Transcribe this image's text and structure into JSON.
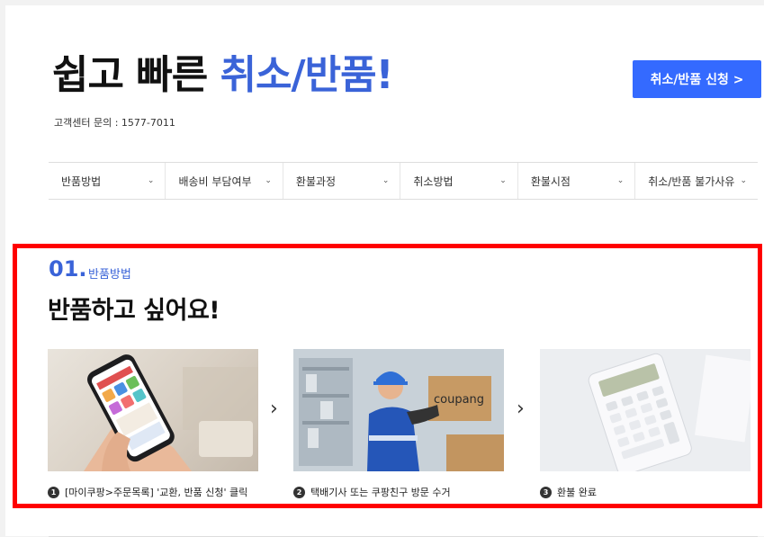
{
  "header": {
    "title_main": "쉽고 빠른 ",
    "title_accent": "취소/반품!",
    "contact": "고객센터 문의 : 1577-7011",
    "apply_button": "취소/반품 신청 >"
  },
  "nav": {
    "items": [
      {
        "label": "반품방법"
      },
      {
        "label": "배송비 부담여부"
      },
      {
        "label": "환불과정"
      },
      {
        "label": "취소방법"
      },
      {
        "label": "환불시점"
      },
      {
        "label": "취소/반품 불가사유"
      }
    ]
  },
  "section": {
    "number": "01.",
    "label": "반품방법",
    "title": "반품하고 싶어요!",
    "steps": [
      {
        "num": "1",
        "caption": "[마이쿠팡>주문목록] '교환, 반품 신청' 클릭"
      },
      {
        "num": "2",
        "caption": "택배기사 또는 쿠팡친구 방문 수거"
      },
      {
        "num": "3",
        "caption": "환불 완료"
      }
    ],
    "box_brand": "coupang"
  },
  "colors": {
    "accent": "#3a63d8",
    "button": "#346aff",
    "highlight_border": "#ff0000"
  }
}
